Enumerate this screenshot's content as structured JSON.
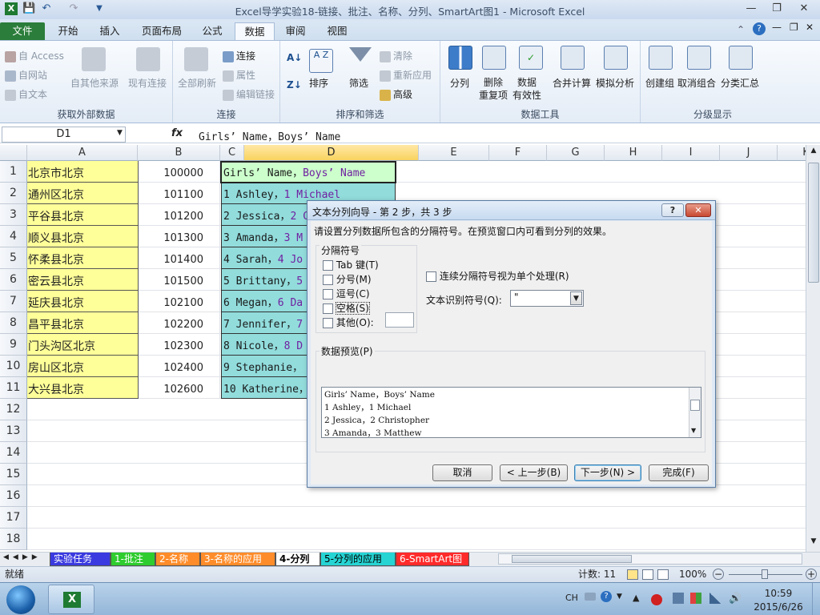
{
  "window": {
    "title": "Excel导学实验18-链接、批注、名称、分列、SmartArt图1 - Microsoft Excel"
  },
  "ribbon_tabs": [
    "文件",
    "开始",
    "插入",
    "页面布局",
    "公式",
    "数据",
    "审阅",
    "视图"
  ],
  "ribbon": {
    "external": {
      "access": "自 Access",
      "web": "自网站",
      "text": "自文本",
      "other": "自其他来源",
      "existing": "现有连接",
      "label": "获取外部数据"
    },
    "connections": {
      "refresh": "全部刷新",
      "connections": "连接",
      "properties": "属性",
      "edit_links": "编辑链接",
      "label": "连接"
    },
    "sort": {
      "sort": "排序",
      "filter": "筛选",
      "clear": "清除",
      "reapply": "重新应用",
      "advanced": "高级",
      "label": "排序和筛选"
    },
    "tools": {
      "split": "分列",
      "remove_dup": "删除\n重复项",
      "validation": "数据\n有效性",
      "consolidate": "合并计算",
      "whatif": "模拟分析",
      "label": "数据工具"
    },
    "outline": {
      "group": "创建组",
      "ungroup": "取消组合",
      "subtotal": "分类汇总",
      "label": "分级显示"
    }
  },
  "formula_bar": {
    "name_box": "D1",
    "fx": "fx",
    "content": "Girls’ Name，Boys’ Name"
  },
  "columns": [
    "A",
    "B",
    "C",
    "D",
    "E",
    "F",
    "G",
    "H",
    "I",
    "J",
    "K"
  ],
  "rows": [
    {
      "n": "1",
      "a": "北京市北京",
      "b": "100000",
      "d1": "Girls’ Name，",
      "d2": "Boys’ Name"
    },
    {
      "n": "2",
      "a": "通州区北京",
      "b": "101100",
      "d1": "1 Ashley，",
      "d2": "1 Michael"
    },
    {
      "n": "3",
      "a": "平谷县北京",
      "b": "101200",
      "d1": "2 Jessica，",
      "d2": "2 C"
    },
    {
      "n": "4",
      "a": "顺义县北京",
      "b": "101300",
      "d1": "3 Amanda，",
      "d2": "3 M"
    },
    {
      "n": "5",
      "a": "怀柔县北京",
      "b": "101400",
      "d1": "4 Sarah，",
      "d2": "4 Jo"
    },
    {
      "n": "6",
      "a": "密云县北京",
      "b": "101500",
      "d1": "5 Brittany，",
      "d2": "5"
    },
    {
      "n": "7",
      "a": "延庆县北京",
      "b": "102100",
      "d1": "6 Megan，",
      "d2": "6 Da"
    },
    {
      "n": "8",
      "a": "昌平县北京",
      "b": "102200",
      "d1": "7 Jennifer，",
      "d2": "7"
    },
    {
      "n": "9",
      "a": "门头沟区北京",
      "b": "102300",
      "d1": "8 Nicole，",
      "d2": "8 D"
    },
    {
      "n": "10",
      "a": "房山区北京",
      "b": "102400",
      "d1": "9 Stephanie，",
      "d2": ""
    },
    {
      "n": "11",
      "a": "大兴县北京",
      "b": "102600",
      "d1": "10 Katherine，",
      "d2": ""
    },
    {
      "n": "12"
    },
    {
      "n": "13"
    },
    {
      "n": "14"
    },
    {
      "n": "15"
    },
    {
      "n": "16"
    },
    {
      "n": "17"
    },
    {
      "n": "18"
    }
  ],
  "sheet_tabs": [
    {
      "label": "实验任务",
      "color": "#3a3ae0",
      "fg": "#ffffff"
    },
    {
      "label": "1-批注",
      "color": "#2ecc2e",
      "fg": "#ffffff"
    },
    {
      "label": "2-名称",
      "color": "#ff8c2a",
      "fg": "#ffffff"
    },
    {
      "label": "3-名称的应用",
      "color": "#ff8c2a",
      "fg": "#ffffff"
    },
    {
      "label": "4-分列",
      "color": "#ffffff",
      "fg": "#000000"
    },
    {
      "label": "5-分列的应用",
      "color": "#26d4d4",
      "fg": "#000000"
    },
    {
      "label": "6-SmartArt图",
      "color": "#ff2a2a",
      "fg": "#ffffff"
    }
  ],
  "status": {
    "ready": "就绪",
    "count": "计数: 11",
    "zoom": "100%"
  },
  "taskbar": {
    "lang": "CH",
    "time": "10:59",
    "date": "2015/6/26"
  },
  "dialog": {
    "title": "文本分列向导 - 第 2 步，共 3 步",
    "instruction": "请设置分列数据所包含的分隔符号。在预览窗口内可看到分列的效果。",
    "delim_group": "分隔符号",
    "delims": [
      "Tab 键(T)",
      "分号(M)",
      "逗号(C)",
      "空格(S)",
      "其他(O):"
    ],
    "consecutive": "连续分隔符号视为单个处理(R)",
    "qualifier_label": "文本识别符号(Q):",
    "qualifier_value": "\"",
    "preview_label": "数据预览(P)",
    "preview_lines": [
      "Girls’ Name，Boys’ Name",
      "1 Ashley，1 Michael",
      "2 Jessica，2 Christopher",
      "3 Amanda，3 Matthew"
    ],
    "buttons": {
      "cancel": "取消",
      "back": "< 上一步(B)",
      "next": "下一步(N) >",
      "finish": "完成(F)"
    }
  }
}
